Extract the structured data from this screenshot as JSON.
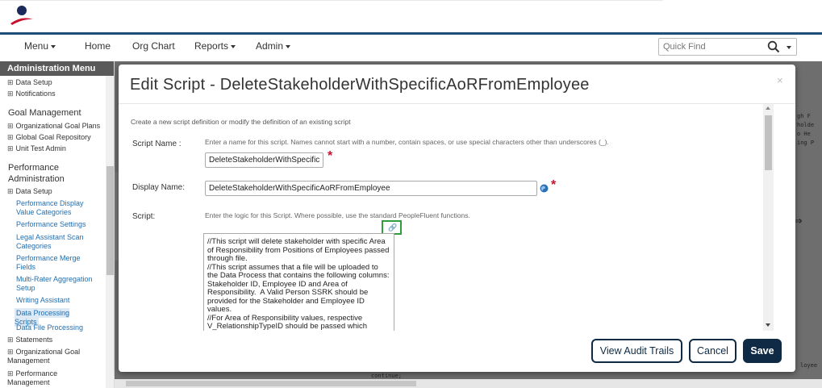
{
  "nav": {
    "items": [
      {
        "label": "Menu",
        "dropdown": true
      },
      {
        "label": "Home",
        "dropdown": false
      },
      {
        "label": "Org Chart",
        "dropdown": false
      },
      {
        "label": "Reports",
        "dropdown": true
      },
      {
        "label": "Admin",
        "dropdown": true
      }
    ],
    "quick_find_placeholder": "Quick Find"
  },
  "sidebar": {
    "title": "Administration Menu",
    "items": {
      "data_setup_top": "Data Setup",
      "notifications": "Notifications",
      "goal_management": "Goal Management",
      "organizational_goal_plans": "Organizational Goal Plans",
      "global_goal_repository": "Global Goal Repository",
      "unit_test_admin": "Unit Test Admin",
      "performance_administration": "Performance Administration",
      "data_setup": "Data Setup",
      "performance_display_value_categories": "Performance Display Value Categories",
      "performance_settings": "Performance Settings",
      "legal_assistant_scan_categories": "Legal Assistant Scan Categories",
      "performance_merge_fields": "Performance Merge Fields",
      "multi_rater_aggregation_setup": "Multi-Rater Aggregation Setup",
      "writing_assistant": "Writing Assistant",
      "data_processing_scripts": "Data Processing Scripts",
      "data_file_processing": "Data File Processing",
      "statements": "Statements",
      "organizational_goal_management": "Organizational Goal Management",
      "performance_management": "Performance Management"
    }
  },
  "backdrop_code": {
    "line1": "gh F",
    "line2": "holde",
    "line3": "o He",
    "line4": "ing P",
    "continue": "continue;",
    "right_bottom": "loyee"
  },
  "modal": {
    "title": "Edit Script - DeleteStakeholderWithSpecificAoRFromEmployee",
    "close": "×",
    "intro": "Create a new script definition or modify the definition of an existing script",
    "script_name_label": "Script Name :",
    "script_name_help": "Enter a name for this script. Names cannot start with a number, contain spaces, or use special characters other than underscores (_).",
    "script_name_value": "DeleteStakeholderWithSpecific",
    "display_name_label": "Display Name:",
    "display_name_value": "DeleteStakeholderWithSpecificAoRFromEmployee",
    "script_label": "Script:",
    "script_help": "Enter the logic for this Script. Where possible, use the standard PeopleFluent functions.",
    "required_mark": "*",
    "script_text": "//This script will delete stakeholder with specific Area of Responsibility from Positions of Employees passed through file.\n//This script assumes that a file will be uploaded to the Data Process that contains the following columns:  Stakeholder ID, Employee ID and Area of Responsibility.  A Valid Person SSRK should be provided for the Stakeholder and Employee ID values.\n//For Area of Responsibility values, respective\nV_RelationshipTypeID should be passed which",
    "buttons": {
      "audit": "View Audit Trails",
      "cancel": "Cancel",
      "save": "Save"
    }
  },
  "colors": {
    "nav_border": "#1f4e79",
    "primary_button": "#0e2a45",
    "required": "#c8102e",
    "highlight_box": "#2e9e3e"
  }
}
